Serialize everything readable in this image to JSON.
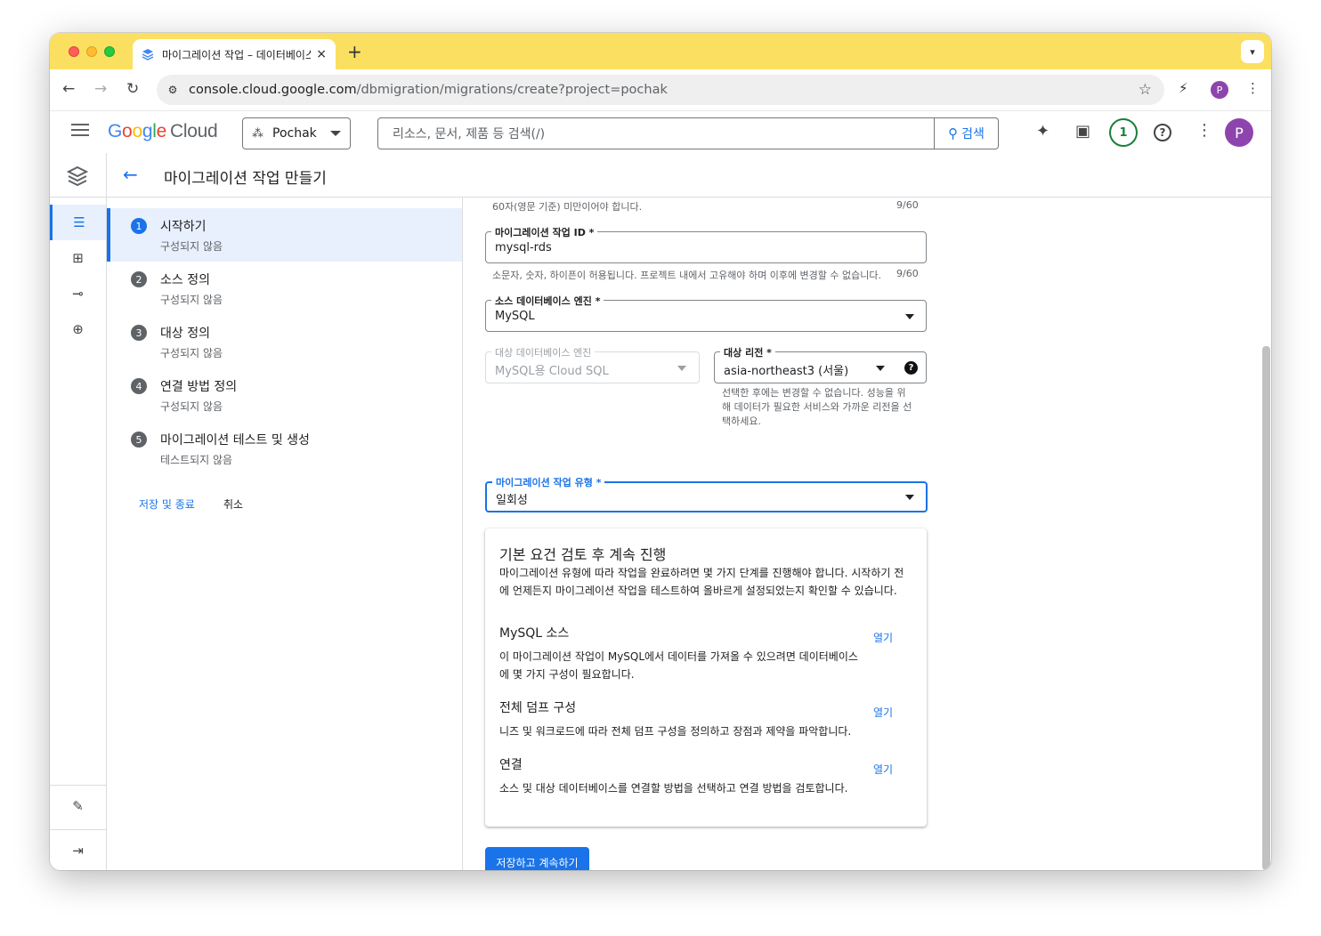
{
  "browser": {
    "tab_title": "마이그레이션 작업 – 데이터베이스",
    "tab_close": "×",
    "new_tab": "+",
    "url_host": "console.cloud.google.com",
    "url_path": "/dbmigration/migrations/create?project=pochak",
    "profile_initial": "P"
  },
  "header": {
    "logo_google": [
      "G",
      "o",
      "o",
      "g",
      "l",
      "e"
    ],
    "logo_cloud": "Cloud",
    "project_name": "Pochak",
    "search_placeholder": "리소스, 문서, 제품 등 검색(/)",
    "search_button": "검색",
    "notification_count": "1",
    "avatar_initial": "P"
  },
  "page": {
    "title": "마이그레이션 작업 만들기"
  },
  "stepper": {
    "steps": [
      {
        "num": "1",
        "title": "시작하기",
        "status": "구성되지 않음"
      },
      {
        "num": "2",
        "title": "소스 정의",
        "status": "구성되지 않음"
      },
      {
        "num": "3",
        "title": "대상 정의",
        "status": "구성되지 않음"
      },
      {
        "num": "4",
        "title": "연결 방법 정의",
        "status": "구성되지 않음"
      },
      {
        "num": "5",
        "title": "마이그레이션 테스트 및 생성",
        "status": "테스트되지 않음"
      }
    ],
    "save_exit": "저장 및 종료",
    "cancel": "취소"
  },
  "form": {
    "name_hint": "60자(영문 기준) 미만이어야 합니다.",
    "name_counter": "9/60",
    "job_id": {
      "label": "마이그레이션 작업 ID *",
      "value": "mysql-rds",
      "hint": "소문자, 숫자, 하이픈이 허용됩니다. 프로젝트 내에서 고유해야 하며 이후에 변경할 수 없습니다.",
      "counter": "9/60"
    },
    "source_engine": {
      "label": "소스 데이터베이스 엔진 *",
      "value": "MySQL"
    },
    "dest_engine": {
      "label": "대상 데이터베이스 엔진",
      "value": "MySQL용 Cloud SQL"
    },
    "dest_region": {
      "label": "대상 리전 *",
      "value": "asia-northeast3 (서울)",
      "help": "?",
      "hint": "선택한 후에는 변경할 수 없습니다. 성능을 위해 데이터가 필요한 서비스와 가까운 리전을 선택하세요."
    },
    "job_type": {
      "label": "마이그레이션 작업 유형 *",
      "value": "일회성"
    }
  },
  "card": {
    "title": "기본 요건 검토 후 계속 진행",
    "description": "마이그레이션 유형에 따라 작업을 완료하려면 몇 가지 단계를 진행해야 합니다. 시작하기 전에 언제든지 마이그레이션 작업을 테스트하여 올바르게 설정되었는지 확인할 수 있습니다.",
    "sections": [
      {
        "title": "MySQL 소스",
        "desc": "이 마이그레이션 작업이 MySQL에서 데이터를 가져올 수 있으려면 데이터베이스에 몇 가지 구성이 필요합니다.",
        "open": "열기"
      },
      {
        "title": "전체 덤프 구성",
        "desc": "니즈 및 워크로드에 따라 전체 덤프 구성을 정의하고 장점과 제약을 파악합니다.",
        "open": "열기"
      },
      {
        "title": "연결",
        "desc": "소스 및 대상 데이터베이스를 연결할 방법을 선택하고 연결 방법을 검토합니다.",
        "open": "열기"
      }
    ]
  },
  "actions": {
    "save_continue": "저장하고 계속하기"
  },
  "colors": {
    "accent": "#1a73e8",
    "tabstrip": "#fbdf61",
    "avatar": "#8e44ad",
    "notification": "#188038"
  }
}
